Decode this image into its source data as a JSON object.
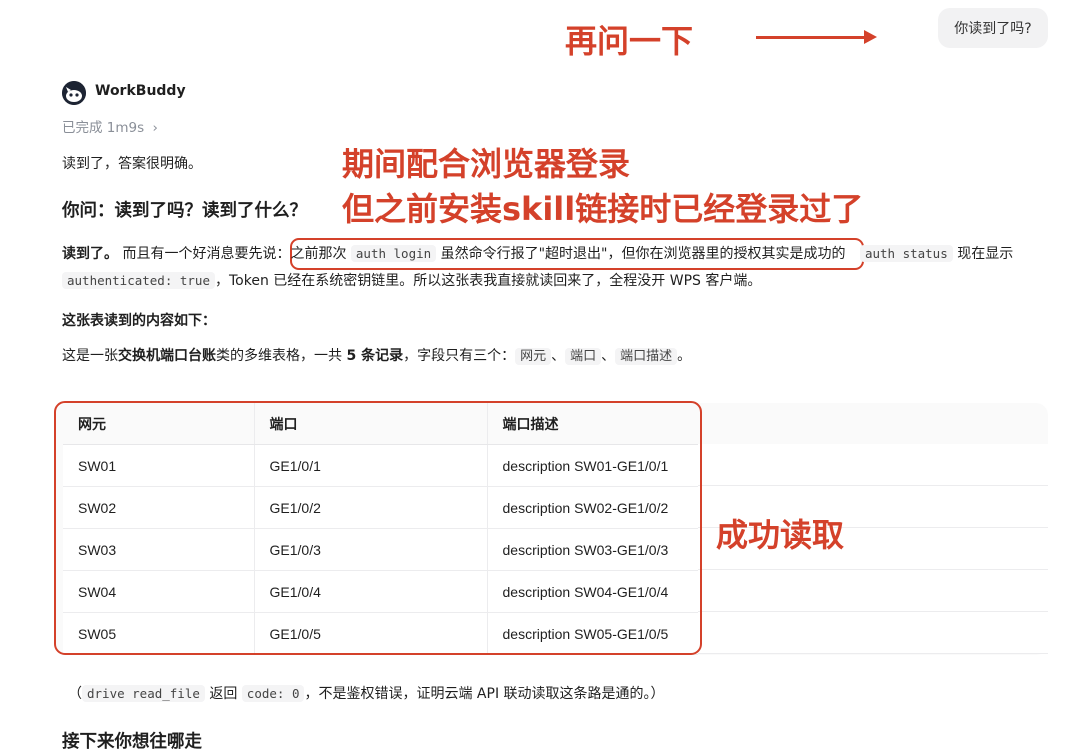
{
  "annotations": {
    "ask_again": "再问一下",
    "browser_login_line1": "期间配合浏览器登录",
    "browser_login_line2": "但之前安装skill链接时已经登录过了",
    "read_success": "成功读取"
  },
  "user_message": "你读到了吗?",
  "assistant": {
    "name": "WorkBuddy",
    "status": "已完成 1m9s",
    "status_chevron": "›"
  },
  "answer": {
    "intro": "读到了，答案很明确。",
    "heading": "你问：读到了吗？读到了什么？",
    "para1": {
      "bold_lead": "读到了。",
      "text_a": "而且有一个好消息要先说：",
      "highlight_a": "之前那次 ",
      "code_auth_login": "auth login",
      "highlight_b": " 虽然命令行报了\"超时退出\"，但你在浏览器里的授权其实是成功的",
      "code_auth_status": "auth status",
      "text_b": " 现在显示",
      "code_authenticated": "authenticated: true",
      "text_c": "，Token 已经在系统密钥链里。所以这张表我直接就读回来了，全程没开 WPS 客户端。"
    },
    "section_title": "这张表读到的内容如下：",
    "para2": {
      "text_a": "这是一张",
      "bold_a": "交换机端口台账",
      "text_b": "类的多维表格，一共 ",
      "bold_b": "5 条记录",
      "text_c": "，字段只有三个：",
      "field1": "网元",
      "sep1": "、",
      "field2": "端口",
      "sep2": "、",
      "field3": "端口描述",
      "end": "。"
    },
    "table": {
      "headers": [
        "网元",
        "端口",
        "端口描述"
      ],
      "rows": [
        [
          "SW01",
          "GE1/0/1",
          "description SW01-GE1/0/1"
        ],
        [
          "SW02",
          "GE1/0/2",
          "description SW02-GE1/0/2"
        ],
        [
          "SW03",
          "GE1/0/3",
          "description SW03-GE1/0/3"
        ],
        [
          "SW04",
          "GE1/0/4",
          "description SW04-GE1/0/4"
        ],
        [
          "SW05",
          "GE1/0/5",
          "description SW05-GE1/0/5"
        ]
      ]
    },
    "footnote": {
      "open": "（",
      "code_a": "drive read_file",
      "text_a": " 返回 ",
      "code_b": "code: 0",
      "text_b": "，不是鉴权错误，证明云端 API 联动读取这条路是通的。）"
    },
    "next_heading": "接下来你想往哪走"
  },
  "colors": {
    "annotation": "#d4412a",
    "logo_bg": "#1d2433",
    "muted": "#8a8f98"
  },
  "icons": {
    "logo": "workbuddy-logo-icon",
    "chevron": "chevron-right-icon",
    "arrow": "arrow-right-icon"
  }
}
